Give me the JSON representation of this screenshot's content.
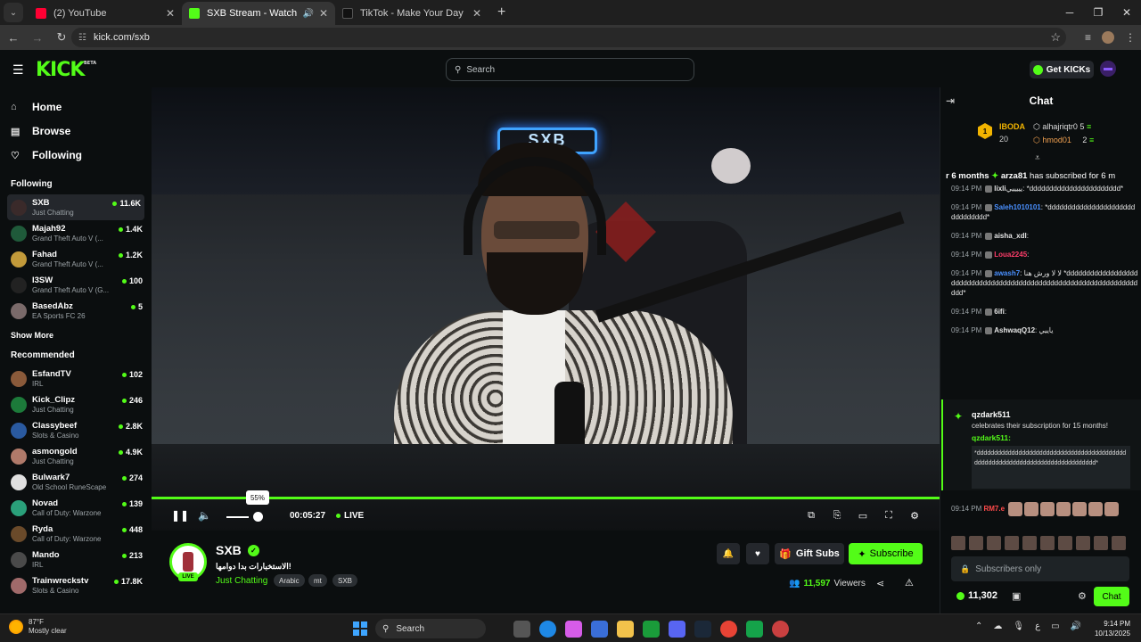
{
  "browser": {
    "tabs": [
      {
        "title": "(2) YouTube",
        "active": false,
        "favicon_color": "#ff0033"
      },
      {
        "title": "SXB Stream - Watch Live on",
        "active": true,
        "favicon_color": "#53fc18"
      },
      {
        "title": "TikTok - Make Your Day",
        "active": false,
        "favicon_color": "#111111"
      }
    ],
    "new_tab": "+",
    "url": "kick.com/sxb"
  },
  "header": {
    "logo": "KICK",
    "logo_beta": "BETA",
    "search_placeholder": "Search",
    "get_kicks_label": "Get KICKs"
  },
  "sidebar": {
    "nav": [
      {
        "label": "Home",
        "icon": "home-icon"
      },
      {
        "label": "Browse",
        "icon": "browse-icon"
      },
      {
        "label": "Following",
        "icon": "heart-icon"
      }
    ],
    "following_title": "Following",
    "following": [
      {
        "name": "SXB",
        "category": "Just Chatting",
        "viewers": "11.6K",
        "avatar": "#3a2a2a"
      },
      {
        "name": "Majah92",
        "category": "Grand Theft Auto V (...",
        "viewers": "1.4K",
        "avatar": "#1f5a3a"
      },
      {
        "name": "Fahad",
        "category": "Grand Theft Auto V (...",
        "viewers": "1.2K",
        "avatar": "#c29a3a"
      },
      {
        "name": "I3SW",
        "category": "Grand Theft Auto V (G...",
        "viewers": "100",
        "avatar": "#222222"
      },
      {
        "name": "BasedAbz",
        "category": "EA Sports FC 26",
        "viewers": "5",
        "avatar": "#7a6a6a"
      }
    ],
    "show_more": "Show More",
    "recommended_title": "Recommended",
    "recommended": [
      {
        "name": "EsfandTV",
        "category": "IRL",
        "viewers": "102",
        "avatar": "#8a5a3a"
      },
      {
        "name": "Kick_Clipz",
        "category": "Just Chatting",
        "viewers": "246",
        "avatar": "#1c7a3a"
      },
      {
        "name": "Classybeef",
        "category": "Slots & Casino",
        "viewers": "2.8K",
        "avatar": "#2a5aa0"
      },
      {
        "name": "asmongold",
        "category": "Just Chatting",
        "viewers": "4.9K",
        "avatar": "#b07a6a"
      },
      {
        "name": "Bulwark7",
        "category": "Old School RuneScape",
        "viewers": "274",
        "avatar": "#e0e0e0"
      },
      {
        "name": "Novad",
        "category": "Call of Duty: Warzone",
        "viewers": "139",
        "avatar": "#2aa07a"
      },
      {
        "name": "Ryda",
        "category": "Call of Duty: Warzone",
        "viewers": "448",
        "avatar": "#6a4a2a"
      },
      {
        "name": "Mando",
        "category": "IRL",
        "viewers": "213",
        "avatar": "#4a4a4a"
      },
      {
        "name": "Trainwreckstv",
        "category": "Slots & Casino",
        "viewers": "17.8K",
        "avatar": "#a06a6a"
      }
    ]
  },
  "player": {
    "neon_sign": "SXB",
    "volume_tooltip": "55%",
    "volume_level": 0.55,
    "elapsed": "00:05:27",
    "live_label": "LIVE"
  },
  "stream": {
    "name": "SXB",
    "title": "!الاستخبارات بدا دوامها",
    "category": "Just Chatting",
    "tags": [
      "Arabic",
      "mt",
      "SXB"
    ],
    "live_badge": "LIVE",
    "gift_subs_label": "Gift Subs",
    "subscribe_label": "Subscribe",
    "viewer_count": "11,597",
    "viewers_label": "Viewers"
  },
  "chat": {
    "title": "Chat",
    "leaderboard": {
      "rank": "1",
      "top_name": "IBODA",
      "top_count": "20",
      "entries": [
        {
          "name": "alhajriqtr0",
          "count": "5"
        },
        {
          "name": "hmod01",
          "count": "2"
        }
      ]
    },
    "banner_prefix": "r 6 months",
    "banner_user": "arza81",
    "banner_text": "has subscribed for 6 m",
    "messages": [
      {
        "time": "09:14 PM",
        "user": "lixli",
        "color": "#e6e6e6",
        "text": "يييييي: *ddddddddddddddddddddddd*"
      },
      {
        "time": "09:14 PM",
        "user": "Saleh1010101",
        "color": "#4a90ff",
        "text": ": *ddddddddddddddddddddddddddddddd*"
      },
      {
        "time": "09:14 PM",
        "user": "aisha_xdl",
        "color": "#e6e6e6",
        "text": ":"
      },
      {
        "time": "09:14 PM",
        "user": "Loua2245",
        "color": "#ff3d6a",
        "text": ":"
      },
      {
        "time": "09:14 PM",
        "user": "awash7",
        "color": "#4a90ff",
        "text": ": لا لا ورش هنا *dddddddddddddddddddddddddddddddddddddddddddddddddddddddddddddddddddd*"
      },
      {
        "time": "09:14 PM",
        "user": "6ifi",
        "color": "#e6e6e6",
        "text": ":"
      },
      {
        "time": "09:14 PM",
        "user": "AshwaqQ12",
        "color": "#e6e6e6",
        "text": ": ياييي"
      }
    ],
    "sub_event": {
      "user": "qzdark511",
      "text": "celebrates their subscription for 15 months!",
      "reply_user": "qzdark511:",
      "body": "*dddddddddddddddddddddddddddddddddddddddddddddddddddddddddddddddddddddddddddddd*"
    },
    "last_message": {
      "time": "09:14 PM",
      "user": "RM7.e"
    },
    "subscribers_only": "Subscribers only",
    "kicks_balance": "11,302",
    "send_label": "Chat"
  },
  "taskbar": {
    "temperature": "87°F",
    "weather": "Mostly clear",
    "search_label": "Search",
    "tray_lang": "ع",
    "time": "9:14 PM",
    "date": "10/13/2025"
  }
}
